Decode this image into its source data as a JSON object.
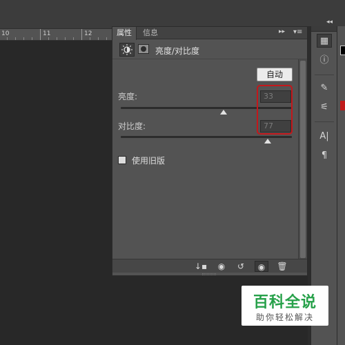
{
  "ruler": {
    "marks": [
      "10",
      "11",
      "12"
    ]
  },
  "panel": {
    "tabs": [
      {
        "label": "属性",
        "active": true
      },
      {
        "label": "信息",
        "active": false
      }
    ],
    "menu_glyph": "▸▸",
    "title": "亮度/对比度",
    "auto_button": "自动",
    "brightness": {
      "label": "亮度:",
      "value": "33",
      "slider_fraction": 0.6
    },
    "contrast": {
      "label": "对比度:",
      "value": "77",
      "slider_fraction": 0.86
    },
    "legacy_checkbox": {
      "label": "使用旧版",
      "checked": false
    }
  },
  "footer_icons": [
    "clip-to-layer-icon",
    "view-previous-state-icon",
    "reset-icon",
    "visibility-eye-icon",
    "trash-icon"
  ],
  "dock_icons": [
    "adjustments-icon",
    "info-icon",
    "brushes-icon",
    "brush-presets-icon",
    "character-icon",
    "paragraph-icon"
  ],
  "colors": {
    "panel_bg": "#535353",
    "highlight_red": "#c4171b",
    "watermark_green": "#27a14a"
  },
  "watermark": {
    "main": "百科全说",
    "sub": "助你轻松解决"
  }
}
